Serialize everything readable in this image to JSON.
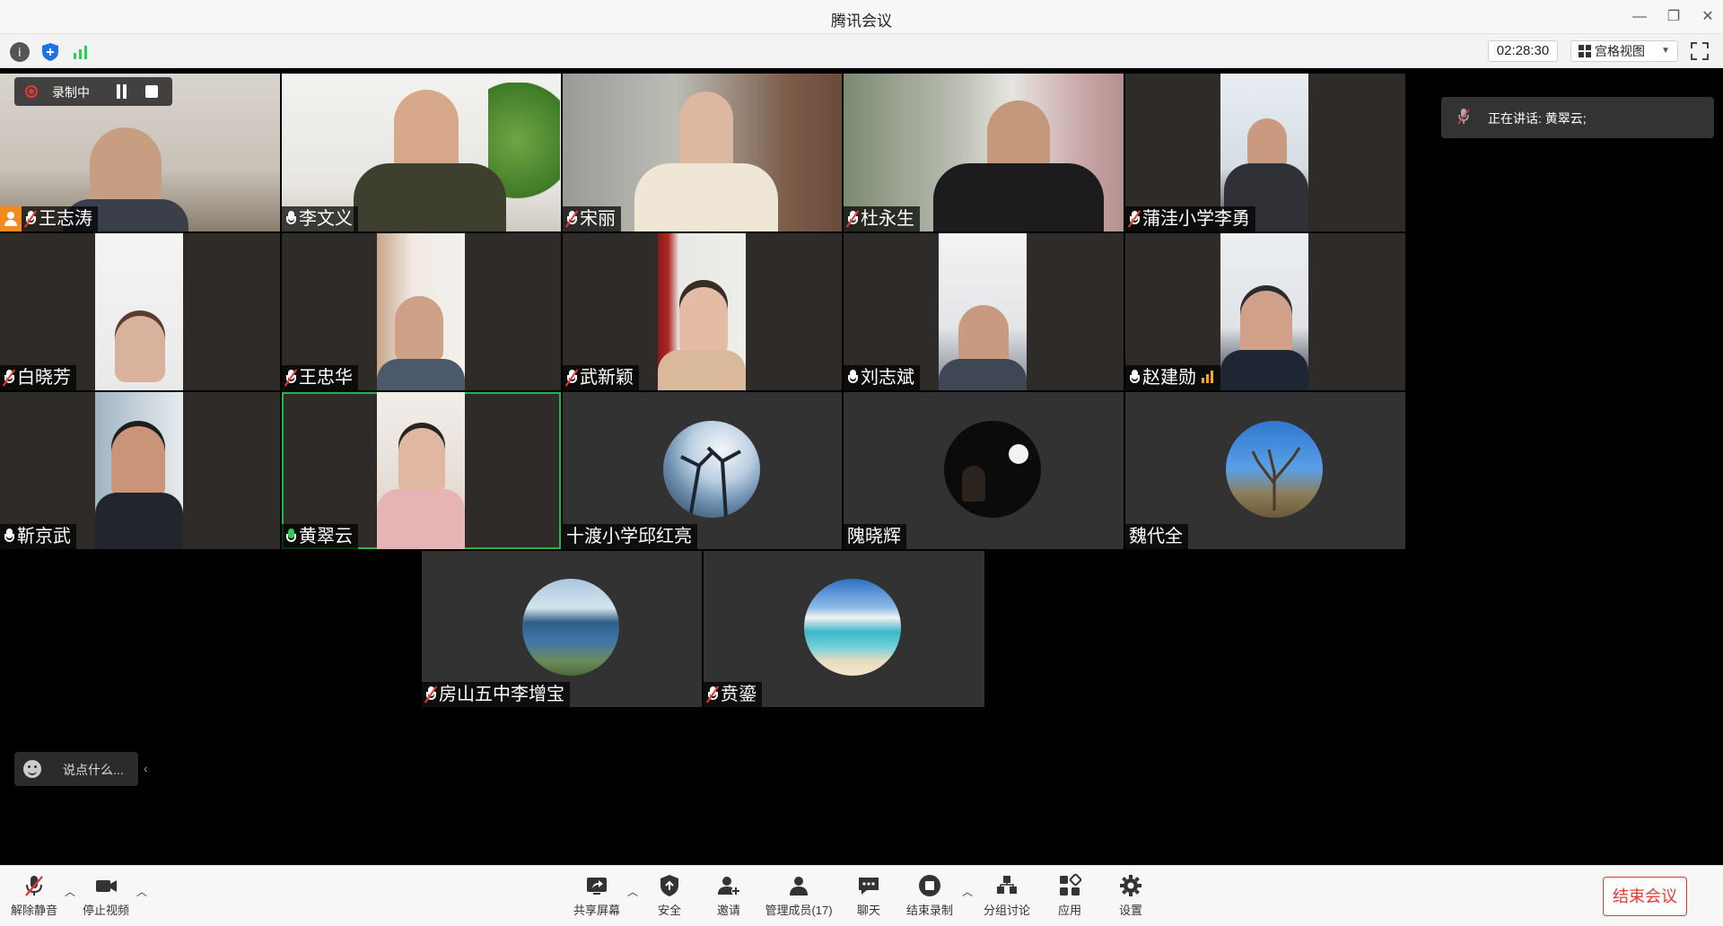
{
  "window": {
    "title": "腾讯会议"
  },
  "infobar": {
    "timer": "02:28:30",
    "view_label": "宫格视图"
  },
  "recording": {
    "label": "录制中"
  },
  "speaking": {
    "label": "正在讲话: 黄翠云;"
  },
  "chat": {
    "placeholder": "说点什么..."
  },
  "participants": [
    {
      "name": "王志涛",
      "mic": "muted",
      "host": true
    },
    {
      "name": "李文义",
      "mic": "on-white"
    },
    {
      "name": "宋丽",
      "mic": "muted"
    },
    {
      "name": "杜永生",
      "mic": "muted"
    },
    {
      "name": "蒲洼小学李勇",
      "mic": "muted"
    },
    {
      "name": "白晓芳",
      "mic": "muted"
    },
    {
      "name": "王忠华",
      "mic": "muted"
    },
    {
      "name": "武新颖",
      "mic": "muted"
    },
    {
      "name": "刘志斌",
      "mic": "on-white"
    },
    {
      "name": "赵建勋",
      "mic": "on-white"
    },
    {
      "name": "靳京武",
      "mic": "on-white"
    },
    {
      "name": "黄翠云",
      "mic": "on-green"
    },
    {
      "name": "十渡小学邱红亮",
      "mic": "none"
    },
    {
      "name": "隗晓辉",
      "mic": "none"
    },
    {
      "name": "魏代全",
      "mic": "none"
    },
    {
      "name": "房山五中李增宝",
      "mic": "muted"
    },
    {
      "name": "贲鎏",
      "mic": "muted"
    }
  ],
  "toolbar": {
    "unmute": "解除静音",
    "stop_video": "停止视频",
    "share": "共享屏幕",
    "security": "安全",
    "invite": "邀请",
    "members": "管理成员(17)",
    "chat": "聊天",
    "end_recording": "结束录制",
    "breakout": "分组讨论",
    "apps": "应用",
    "settings": "设置",
    "end_meeting": "结束会议"
  },
  "colors": {
    "active_speaker": "#27b34b",
    "end_red": "#e53935",
    "host_orange": "#f58b1e"
  }
}
